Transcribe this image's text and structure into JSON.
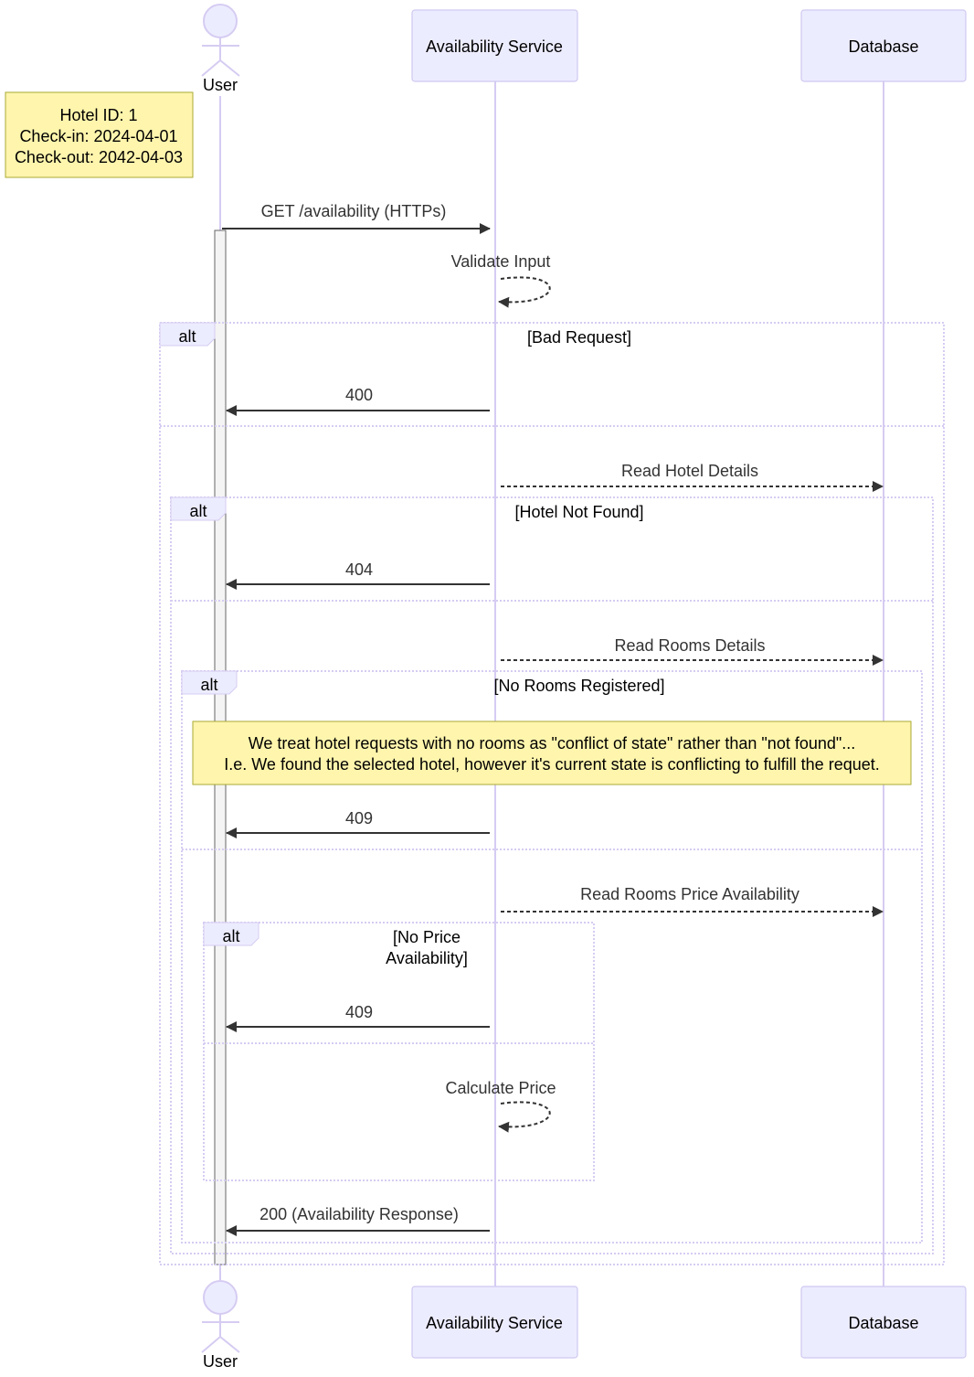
{
  "participants": {
    "user": "User",
    "service": "Availability Service",
    "database": "Database"
  },
  "note_top": {
    "lines": [
      "Hotel ID: 1",
      "Check-in: 2024-04-01",
      "Check-out: 2042-04-03"
    ]
  },
  "messages": {
    "get": "GET /availability (HTTPs)",
    "validate": "Validate Input",
    "r400": "400",
    "read_hotel": "Read Hotel Details",
    "r404": "404",
    "read_rooms": "Read Rooms Details",
    "r409a": "409",
    "read_price": "Read Rooms Price Availability",
    "r409b": "409",
    "calculate": "Calculate Price",
    "r200": "200 (Availability Response)"
  },
  "alts": [
    {
      "label": "alt",
      "condition": [
        "[Bad Request]"
      ]
    },
    {
      "label": "alt",
      "condition": [
        "[Hotel Not Found]"
      ]
    },
    {
      "label": "alt",
      "condition": [
        "[No Rooms Registered]"
      ]
    },
    {
      "label": "alt",
      "condition": [
        "[No Price",
        "Availability]"
      ]
    }
  ],
  "note_rooms": {
    "lines": [
      "We treat hotel requests with no rooms as \"conflict of state\" rather than \"not found\"...",
      "I.e. We found the selected hotel, however it's current state is conflicting to fulfill the requet."
    ]
  },
  "colors": {
    "actor_fill": "#ececff",
    "actor_stroke": "#d6ccf2",
    "note_fill": "#fff5ad",
    "note_stroke": "#aaaa33"
  }
}
